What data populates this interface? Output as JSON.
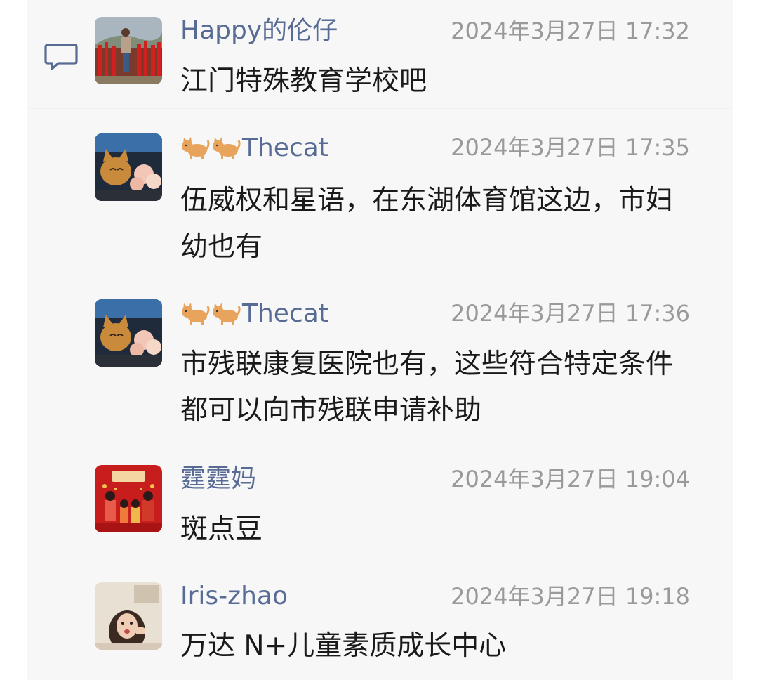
{
  "icons": {
    "comment": "comment-icon",
    "cat": "cat-emoji-icon"
  },
  "colors": {
    "name": "#576b95",
    "time": "#9a9a9a",
    "text": "#1a1a1a",
    "panel": "#f7f7f7"
  },
  "messages": [
    {
      "name": "Happy的伦仔",
      "time": "2024年3月27日 17:32",
      "text": "江门特殊教育学校吧"
    },
    {
      "name_prefix_emoji": "🐈🐈",
      "name": "Thecat",
      "time": "2024年3月27日 17:35",
      "text": "伍威权和星语，在东湖体育馆这边，市妇幼也有"
    },
    {
      "name_prefix_emoji": "🐈🐈",
      "name": "Thecat",
      "time": "2024年3月27日 17:36",
      "text": "市残联康复医院也有，这些符合特定条件都可以向市残联申请补助"
    },
    {
      "name": "霆霆妈",
      "time": "2024年3月27日 19:04",
      "text": "斑点豆"
    },
    {
      "name": "Iris-zhao",
      "time": "2024年3月27日 19:18",
      "text": "万达 N+儿童素质成长中心"
    }
  ]
}
